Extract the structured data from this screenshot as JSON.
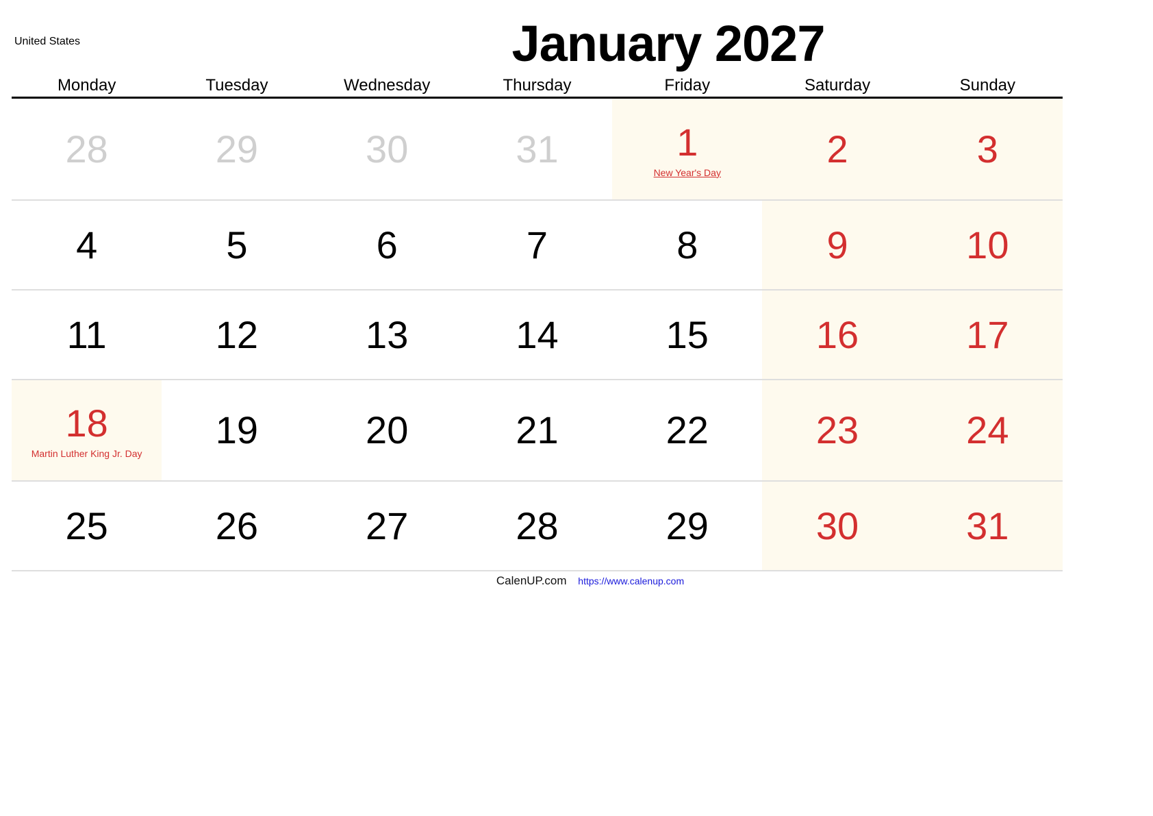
{
  "header": {
    "country": "United States",
    "title": "January 2027"
  },
  "weekdays": [
    "Monday",
    "Tuesday",
    "Wednesday",
    "Thursday",
    "Friday",
    "Saturday",
    "Sunday"
  ],
  "colors": {
    "holiday_red": "#d32f2f",
    "weekend_shade": "#fefaee",
    "other_month_gray": "#cfcfcf",
    "link_blue": "#1a1adb"
  },
  "weeks": [
    [
      {
        "day": "28",
        "type": "other"
      },
      {
        "day": "29",
        "type": "other"
      },
      {
        "day": "30",
        "type": "other"
      },
      {
        "day": "31",
        "type": "other"
      },
      {
        "day": "1",
        "type": "holiday",
        "holiday": "New Year's Day",
        "holiday_link": true,
        "shade": true
      },
      {
        "day": "2",
        "type": "weekend",
        "shade": true
      },
      {
        "day": "3",
        "type": "weekend",
        "shade": true
      }
    ],
    [
      {
        "day": "4",
        "type": "normal"
      },
      {
        "day": "5",
        "type": "normal"
      },
      {
        "day": "6",
        "type": "normal"
      },
      {
        "day": "7",
        "type": "normal"
      },
      {
        "day": "8",
        "type": "normal"
      },
      {
        "day": "9",
        "type": "weekend",
        "shade": true
      },
      {
        "day": "10",
        "type": "weekend",
        "shade": true
      }
    ],
    [
      {
        "day": "11",
        "type": "normal"
      },
      {
        "day": "12",
        "type": "normal"
      },
      {
        "day": "13",
        "type": "normal"
      },
      {
        "day": "14",
        "type": "normal"
      },
      {
        "day": "15",
        "type": "normal"
      },
      {
        "day": "16",
        "type": "weekend",
        "shade": true
      },
      {
        "day": "17",
        "type": "weekend",
        "shade": true
      }
    ],
    [
      {
        "day": "18",
        "type": "holiday",
        "holiday": "Martin Luther King Jr. Day",
        "holiday_link": false,
        "shade": true
      },
      {
        "day": "19",
        "type": "normal"
      },
      {
        "day": "20",
        "type": "normal"
      },
      {
        "day": "21",
        "type": "normal"
      },
      {
        "day": "22",
        "type": "normal"
      },
      {
        "day": "23",
        "type": "weekend",
        "shade": true
      },
      {
        "day": "24",
        "type": "weekend",
        "shade": true
      }
    ],
    [
      {
        "day": "25",
        "type": "normal"
      },
      {
        "day": "26",
        "type": "normal"
      },
      {
        "day": "27",
        "type": "normal"
      },
      {
        "day": "28",
        "type": "normal"
      },
      {
        "day": "29",
        "type": "normal"
      },
      {
        "day": "30",
        "type": "weekend",
        "shade": true
      },
      {
        "day": "31",
        "type": "weekend",
        "shade": true
      }
    ]
  ],
  "footer": {
    "site_name": "CalenUP.com",
    "url": "https://www.calenup.com"
  }
}
